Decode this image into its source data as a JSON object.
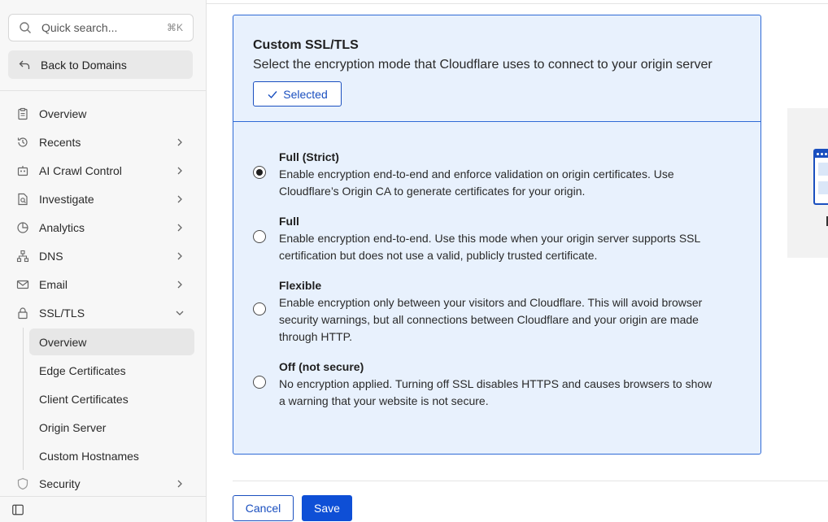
{
  "sidebar": {
    "search_placeholder": "Quick search...",
    "search_shortcut": "⌘K",
    "back_label": "Back to Domains",
    "items": [
      {
        "label": "Overview",
        "icon": "clipboard-icon"
      },
      {
        "label": "Recents",
        "icon": "history-icon"
      },
      {
        "label": "AI Crawl Control",
        "icon": "robot-icon"
      },
      {
        "label": "Investigate",
        "icon": "document-search-icon"
      },
      {
        "label": "Analytics",
        "icon": "pie-chart-icon"
      },
      {
        "label": "DNS",
        "icon": "network-icon"
      },
      {
        "label": "Email",
        "icon": "envelope-icon"
      },
      {
        "label": "SSL/TLS",
        "icon": "lock-icon"
      }
    ],
    "ssl_subitems": [
      {
        "label": "Overview"
      },
      {
        "label": "Edge Certificates"
      },
      {
        "label": "Client Certificates"
      },
      {
        "label": "Origin Server"
      },
      {
        "label": "Custom Hostnames"
      }
    ],
    "security_label": "Security"
  },
  "card": {
    "title": "Custom SSL/TLS",
    "subtitle": "Select the encryption mode that Cloudflare uses to connect to your origin server",
    "selected_label": "Selected",
    "options": [
      {
        "title": "Full (Strict)",
        "desc_1": "Enable encryption end-to-end and enforce validation on origin certificates. Use",
        "desc_2": "Cloudflare’s Origin CA to generate certificates for your origin.",
        "desc_3": "",
        "checked": true
      },
      {
        "title": "Full",
        "desc_1": "Enable encryption end-to-end. Use this mode when your origin server supports SSL",
        "desc_2": "certification but does not use a valid, publicly trusted certificate.",
        "desc_3": "",
        "checked": false
      },
      {
        "title": "Flexible",
        "desc_1": "Enable encryption only between your visitors and Cloudflare. This will avoid browser",
        "desc_2": "security warnings, but all connections between Cloudflare and your origin are made",
        "desc_3": "through HTTP.",
        "checked": false
      },
      {
        "title": "Off (not secure)",
        "desc_1": "No encryption applied. Turning off SSL disables HTTPS and causes browsers to show",
        "desc_2": "a warning that your website is not secure.",
        "desc_3": "",
        "checked": false
      }
    ]
  },
  "footer": {
    "cancel_label": "Cancel",
    "save_label": "Save"
  },
  "colors": {
    "accent": "#0e4fd6",
    "card_bg": "#e8f1fd",
    "card_border": "#2f6ad6"
  }
}
